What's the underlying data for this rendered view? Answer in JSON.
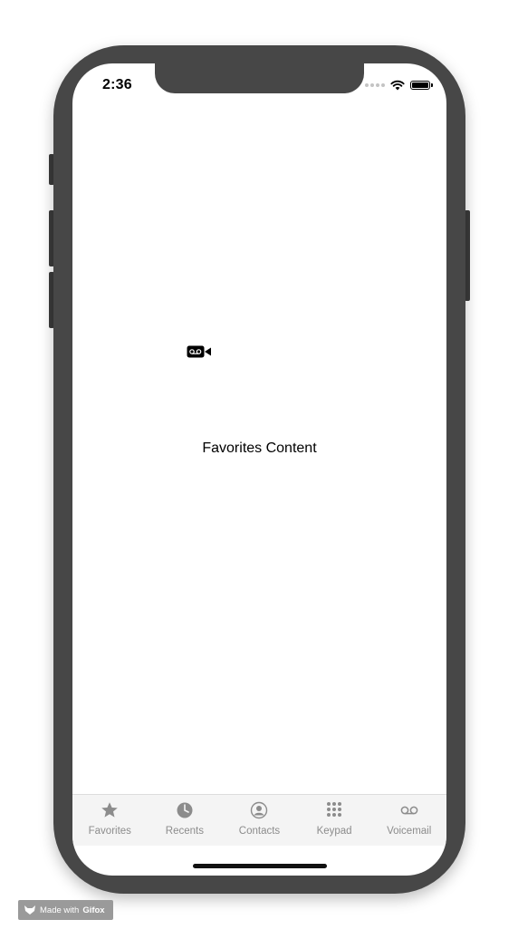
{
  "status_bar": {
    "time": "2:36"
  },
  "content": {
    "label": "Favorites Content",
    "icon": "voicemail-icon"
  },
  "tab_bar": {
    "tabs": [
      {
        "label": "Favorites",
        "icon": "star-icon",
        "active": true
      },
      {
        "label": "Recents",
        "icon": "clock-icon",
        "active": false
      },
      {
        "label": "Contacts",
        "icon": "person-circle-icon",
        "active": false
      },
      {
        "label": "Keypad",
        "icon": "keypad-icon",
        "active": false
      },
      {
        "label": "Voicemail",
        "icon": "voicemail-icon",
        "active": false
      }
    ]
  },
  "watermark": {
    "prefix": "Made with",
    "brand": "Gifox"
  },
  "colors": {
    "frame": "#474747",
    "tab_icon": "#8c8c8c",
    "tab_background": "#f4f4f4"
  }
}
